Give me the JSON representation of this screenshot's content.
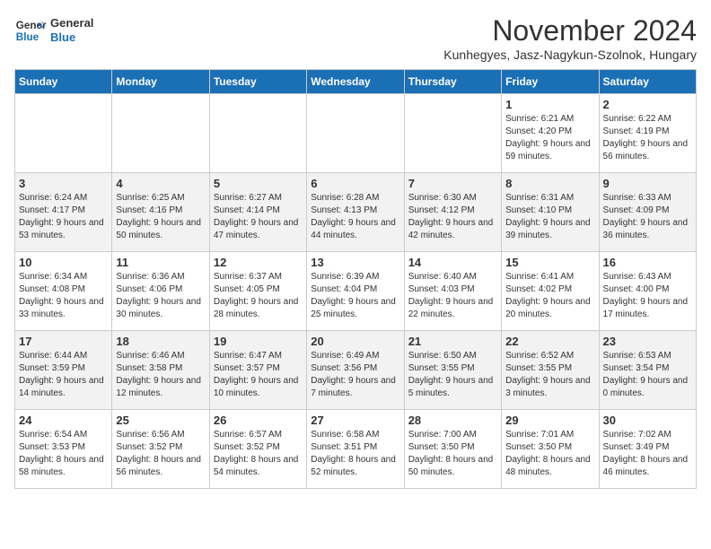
{
  "logo": {
    "line1": "General",
    "line2": "Blue"
  },
  "title": "November 2024",
  "subtitle": "Kunhegyes, Jasz-Nagykun-Szolnok, Hungary",
  "days_of_week": [
    "Sunday",
    "Monday",
    "Tuesday",
    "Wednesday",
    "Thursday",
    "Friday",
    "Saturday"
  ],
  "weeks": [
    [
      {
        "day": "",
        "info": ""
      },
      {
        "day": "",
        "info": ""
      },
      {
        "day": "",
        "info": ""
      },
      {
        "day": "",
        "info": ""
      },
      {
        "day": "",
        "info": ""
      },
      {
        "day": "1",
        "info": "Sunrise: 6:21 AM\nSunset: 4:20 PM\nDaylight: 9 hours and 59 minutes."
      },
      {
        "day": "2",
        "info": "Sunrise: 6:22 AM\nSunset: 4:19 PM\nDaylight: 9 hours and 56 minutes."
      }
    ],
    [
      {
        "day": "3",
        "info": "Sunrise: 6:24 AM\nSunset: 4:17 PM\nDaylight: 9 hours and 53 minutes."
      },
      {
        "day": "4",
        "info": "Sunrise: 6:25 AM\nSunset: 4:16 PM\nDaylight: 9 hours and 50 minutes."
      },
      {
        "day": "5",
        "info": "Sunrise: 6:27 AM\nSunset: 4:14 PM\nDaylight: 9 hours and 47 minutes."
      },
      {
        "day": "6",
        "info": "Sunrise: 6:28 AM\nSunset: 4:13 PM\nDaylight: 9 hours and 44 minutes."
      },
      {
        "day": "7",
        "info": "Sunrise: 6:30 AM\nSunset: 4:12 PM\nDaylight: 9 hours and 42 minutes."
      },
      {
        "day": "8",
        "info": "Sunrise: 6:31 AM\nSunset: 4:10 PM\nDaylight: 9 hours and 39 minutes."
      },
      {
        "day": "9",
        "info": "Sunrise: 6:33 AM\nSunset: 4:09 PM\nDaylight: 9 hours and 36 minutes."
      }
    ],
    [
      {
        "day": "10",
        "info": "Sunrise: 6:34 AM\nSunset: 4:08 PM\nDaylight: 9 hours and 33 minutes."
      },
      {
        "day": "11",
        "info": "Sunrise: 6:36 AM\nSunset: 4:06 PM\nDaylight: 9 hours and 30 minutes."
      },
      {
        "day": "12",
        "info": "Sunrise: 6:37 AM\nSunset: 4:05 PM\nDaylight: 9 hours and 28 minutes."
      },
      {
        "day": "13",
        "info": "Sunrise: 6:39 AM\nSunset: 4:04 PM\nDaylight: 9 hours and 25 minutes."
      },
      {
        "day": "14",
        "info": "Sunrise: 6:40 AM\nSunset: 4:03 PM\nDaylight: 9 hours and 22 minutes."
      },
      {
        "day": "15",
        "info": "Sunrise: 6:41 AM\nSunset: 4:02 PM\nDaylight: 9 hours and 20 minutes."
      },
      {
        "day": "16",
        "info": "Sunrise: 6:43 AM\nSunset: 4:00 PM\nDaylight: 9 hours and 17 minutes."
      }
    ],
    [
      {
        "day": "17",
        "info": "Sunrise: 6:44 AM\nSunset: 3:59 PM\nDaylight: 9 hours and 14 minutes."
      },
      {
        "day": "18",
        "info": "Sunrise: 6:46 AM\nSunset: 3:58 PM\nDaylight: 9 hours and 12 minutes."
      },
      {
        "day": "19",
        "info": "Sunrise: 6:47 AM\nSunset: 3:57 PM\nDaylight: 9 hours and 10 minutes."
      },
      {
        "day": "20",
        "info": "Sunrise: 6:49 AM\nSunset: 3:56 PM\nDaylight: 9 hours and 7 minutes."
      },
      {
        "day": "21",
        "info": "Sunrise: 6:50 AM\nSunset: 3:55 PM\nDaylight: 9 hours and 5 minutes."
      },
      {
        "day": "22",
        "info": "Sunrise: 6:52 AM\nSunset: 3:55 PM\nDaylight: 9 hours and 3 minutes."
      },
      {
        "day": "23",
        "info": "Sunrise: 6:53 AM\nSunset: 3:54 PM\nDaylight: 9 hours and 0 minutes."
      }
    ],
    [
      {
        "day": "24",
        "info": "Sunrise: 6:54 AM\nSunset: 3:53 PM\nDaylight: 8 hours and 58 minutes."
      },
      {
        "day": "25",
        "info": "Sunrise: 6:56 AM\nSunset: 3:52 PM\nDaylight: 8 hours and 56 minutes."
      },
      {
        "day": "26",
        "info": "Sunrise: 6:57 AM\nSunset: 3:52 PM\nDaylight: 8 hours and 54 minutes."
      },
      {
        "day": "27",
        "info": "Sunrise: 6:58 AM\nSunset: 3:51 PM\nDaylight: 8 hours and 52 minutes."
      },
      {
        "day": "28",
        "info": "Sunrise: 7:00 AM\nSunset: 3:50 PM\nDaylight: 8 hours and 50 minutes."
      },
      {
        "day": "29",
        "info": "Sunrise: 7:01 AM\nSunset: 3:50 PM\nDaylight: 8 hours and 48 minutes."
      },
      {
        "day": "30",
        "info": "Sunrise: 7:02 AM\nSunset: 3:49 PM\nDaylight: 8 hours and 46 minutes."
      }
    ]
  ]
}
